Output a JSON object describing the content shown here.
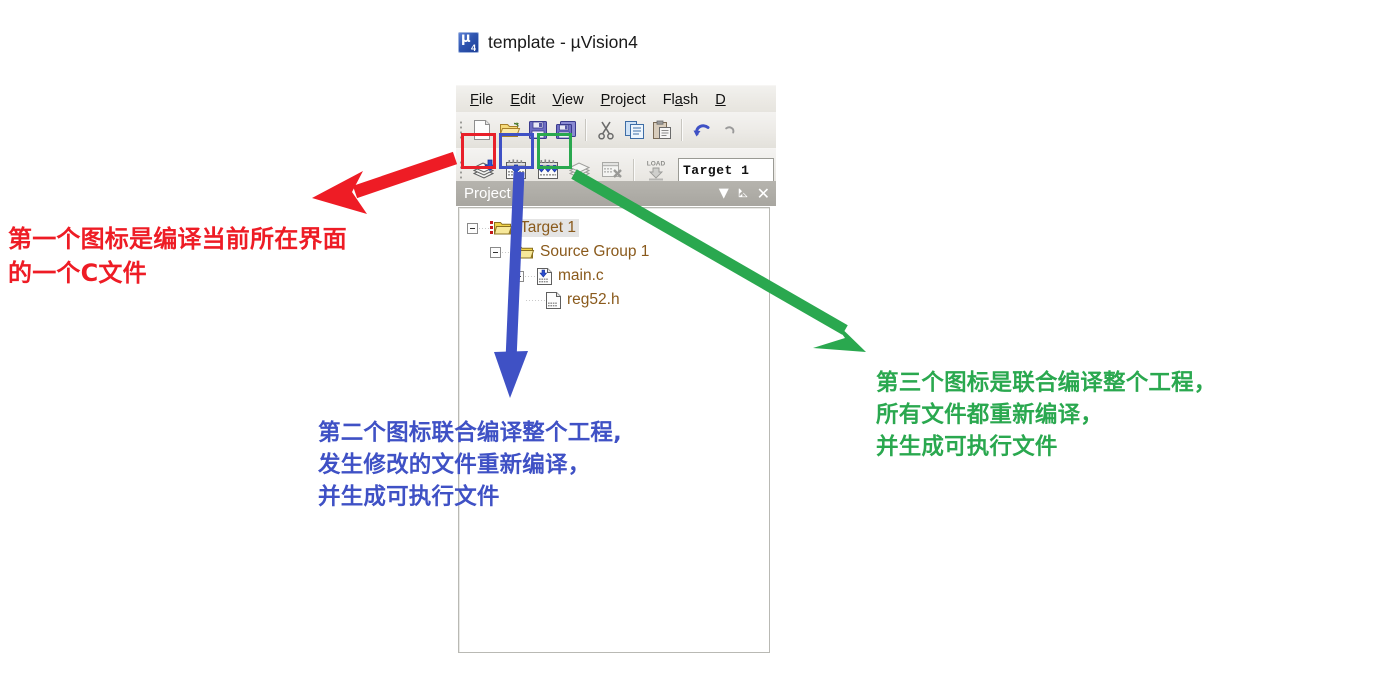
{
  "window": {
    "title": "template  - µVision4",
    "app_icon": "uvision-app-icon",
    "menu": [
      {
        "pre": "",
        "hot": "F",
        "post": "ile"
      },
      {
        "pre": "",
        "hot": "E",
        "post": "dit"
      },
      {
        "pre": "",
        "hot": "V",
        "post": "iew"
      },
      {
        "pre": "",
        "hot": "P",
        "post": "roject"
      },
      {
        "pre": "Fl",
        "hot": "a",
        "post": "sh"
      },
      {
        "pre": "",
        "hot": "D",
        "post": ""
      }
    ],
    "menu_labels": [
      "File",
      "Edit",
      "View",
      "Project",
      "Flash",
      "D"
    ]
  },
  "toolbar_standard": {
    "buttons": [
      {
        "name": "new-file-icon",
        "label": "New"
      },
      {
        "name": "open-file-icon",
        "label": "Open"
      },
      {
        "name": "save-icon",
        "label": "Save"
      },
      {
        "name": "save-all-icon",
        "label": "Save All"
      },
      {
        "name": "cut-icon",
        "label": "Cut"
      },
      {
        "name": "copy-icon",
        "label": "Copy"
      },
      {
        "name": "paste-icon",
        "label": "Paste"
      },
      {
        "name": "undo-icon",
        "label": "Undo"
      },
      {
        "name": "redo-icon",
        "label": "Redo"
      }
    ]
  },
  "toolbar_build": {
    "buttons": [
      {
        "name": "translate-file-icon",
        "label": "Translate current file",
        "highlight": "red"
      },
      {
        "name": "build-target-icon",
        "label": "Build target",
        "highlight": "blue"
      },
      {
        "name": "rebuild-all-icon",
        "label": "Rebuild all target files",
        "highlight": "green"
      },
      {
        "name": "batch-build-icon",
        "label": "Batch Build",
        "highlight": "none"
      },
      {
        "name": "stop-build-icon",
        "label": "Stop build",
        "highlight": "none"
      },
      {
        "name": "download-icon",
        "label": "LOAD",
        "highlight": "none"
      }
    ],
    "load_label": "LOAD",
    "target_combo_value": "Target 1"
  },
  "project_panel": {
    "title": "Project",
    "header_buttons": [
      {
        "name": "panel-menu-icon",
        "glyph": "▼"
      },
      {
        "name": "panel-pin-icon",
        "glyph": "⚇"
      },
      {
        "name": "panel-close-icon",
        "glyph": "✕"
      }
    ],
    "tree": [
      {
        "label": "Target 1",
        "icon": "target-folder-icon",
        "depth": 0,
        "selected": true,
        "expander": true
      },
      {
        "label": "Source Group 1",
        "icon": "source-group-folder-icon",
        "depth": 1,
        "selected": false,
        "expander": true
      },
      {
        "label": "main.c",
        "icon": "c-source-file-icon",
        "depth": 2,
        "selected": false,
        "expander": true
      },
      {
        "label": "reg52.h",
        "icon": "header-file-icon",
        "depth": 3,
        "selected": false,
        "expander": false
      }
    ]
  },
  "annotations": {
    "red": {
      "text": "第一个图标是编译当前所在界面\n的一个C文件",
      "color": "#ee1c25",
      "arrow": "red-arrow"
    },
    "blue": {
      "text": "第二个图标联合编译整个工程,\n发生修改的文件重新编译，\n并生成可执行文件",
      "color": "#3f51c5",
      "arrow": "blue-arrow"
    },
    "green": {
      "text": "第三个图标是联合编译整个工程，\n所有文件都重新编译，\n并生成可执行文件",
      "color": "#2aa84f",
      "arrow": "green-arrow"
    }
  },
  "colors": {
    "red": "#ee1c25",
    "blue": "#3f51c5",
    "green": "#2aa84f",
    "panel_header": "#a8a6a0",
    "tree_text": "#8a5a1c"
  }
}
